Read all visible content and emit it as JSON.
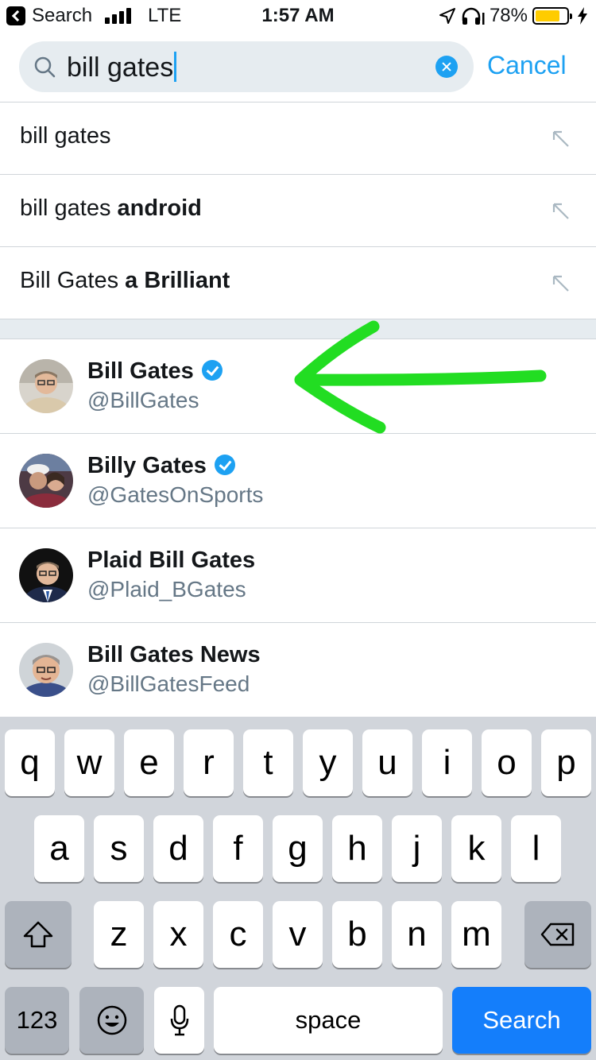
{
  "status_bar": {
    "back_label": "Search",
    "carrier": "LTE",
    "time": "1:57 AM",
    "battery_percent": "78%",
    "battery_level": 0.78,
    "icons": [
      "back-icon",
      "signal-bars-icon",
      "location-arrow-icon",
      "headphones-icon",
      "battery-icon",
      "charging-bolt-icon"
    ]
  },
  "search": {
    "query": "bill gates",
    "cancel_label": "Cancel"
  },
  "suggestions": [
    {
      "prefix": "bill gates",
      "completion": ""
    },
    {
      "prefix": "bill gates",
      "completion": "android"
    },
    {
      "prefix": "Bill Gates",
      "completion": "a Brilliant"
    }
  ],
  "users": [
    {
      "name": "Bill Gates",
      "handle": "@BillGates",
      "verified": true
    },
    {
      "name": "Billy Gates",
      "handle": "@GatesOnSports",
      "verified": true
    },
    {
      "name": "Plaid Bill Gates",
      "handle": "@Plaid_BGates",
      "verified": false
    },
    {
      "name": "Bill Gates News",
      "handle": "@BillGatesFeed",
      "verified": false
    }
  ],
  "annotation": {
    "color": "#22dd22"
  },
  "keyboard": {
    "row1": [
      "q",
      "w",
      "e",
      "r",
      "t",
      "y",
      "u",
      "i",
      "o",
      "p"
    ],
    "row2": [
      "a",
      "s",
      "d",
      "f",
      "g",
      "h",
      "j",
      "k",
      "l"
    ],
    "row3": [
      "z",
      "x",
      "c",
      "v",
      "b",
      "n",
      "m"
    ],
    "numbers_label": "123",
    "space_label": "space",
    "return_label": "Search"
  },
  "colors": {
    "accent": "#1da1f2",
    "secondary_text": "#657786",
    "keyboard_bg": "#d1d5db",
    "search_key": "#147efb"
  }
}
